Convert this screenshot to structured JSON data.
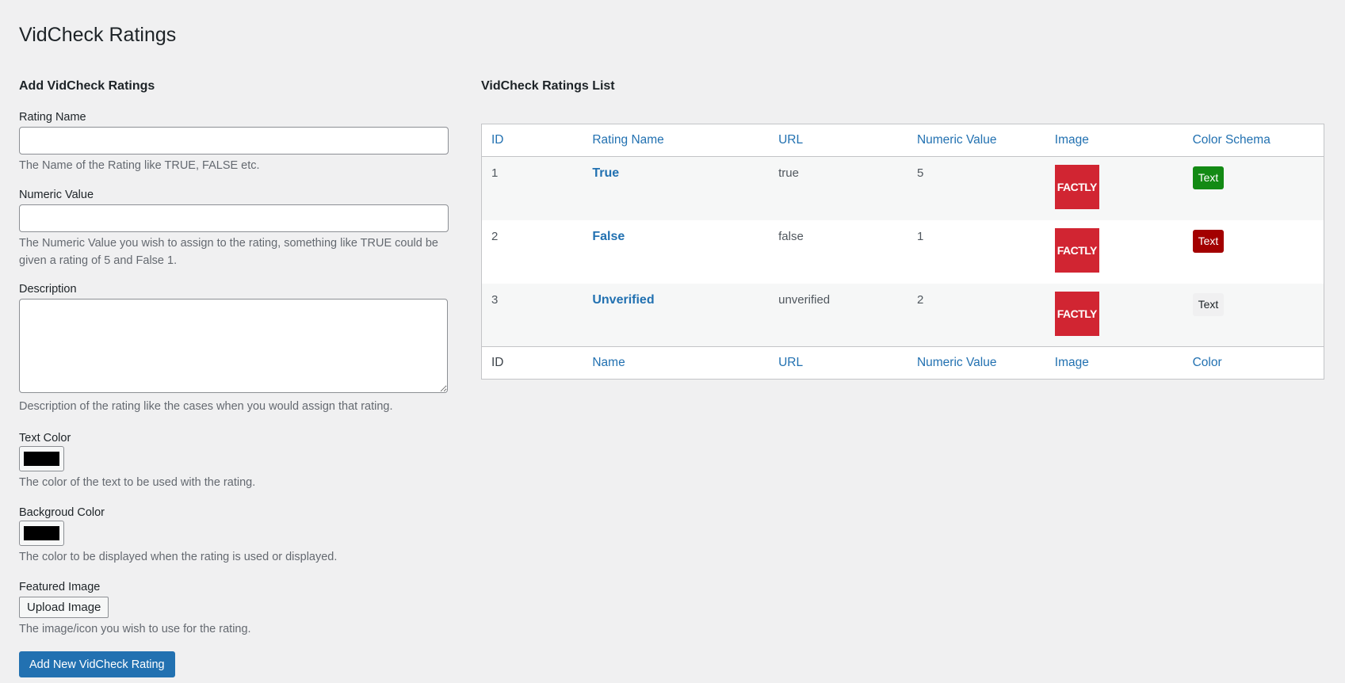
{
  "page_title": "VidCheck Ratings",
  "form": {
    "section_title": "Add VidCheck Ratings",
    "rating_name": {
      "label": "Rating Name",
      "value": "",
      "help": "The Name of the Rating like TRUE, FALSE etc."
    },
    "numeric_value": {
      "label": "Numeric Value",
      "value": "",
      "help": "The Numeric Value you wish to assign to the rating, something like TRUE could be given a rating of 5 and False 1."
    },
    "description": {
      "label": "Description",
      "value": "",
      "help": "Description of the rating like the cases when you would assign that rating."
    },
    "text_color": {
      "label": "Text Color",
      "value": "#000000",
      "help": "The color of the text to be used with the rating."
    },
    "background_color": {
      "label": "Backgroud Color",
      "value": "#000000",
      "help": "The color to be displayed when the rating is used or displayed."
    },
    "featured_image": {
      "label": "Featured Image",
      "button": "Upload Image",
      "help": "The image/icon you wish to use for the rating."
    },
    "submit_label": "Add New VidCheck Rating"
  },
  "list": {
    "section_title": "VidCheck Ratings List",
    "header": [
      "ID",
      "Rating Name",
      "URL",
      "Numeric Value",
      "Image",
      "Color Schema"
    ],
    "footer": [
      "ID",
      "Name",
      "URL",
      "Numeric Value",
      "Image",
      "Color"
    ],
    "rows": [
      {
        "id": "1",
        "name": "True",
        "url": "true",
        "numeric": "5",
        "image_text": "FACTLY",
        "badge_text": "Text",
        "badge_bg": "#138a14",
        "badge_fg": "#ffffff"
      },
      {
        "id": "2",
        "name": "False",
        "url": "false",
        "numeric": "1",
        "image_text": "FACTLY",
        "badge_text": "Text",
        "badge_bg": "#a30000",
        "badge_fg": "#ffffff"
      },
      {
        "id": "3",
        "name": "Unverified",
        "url": "unverified",
        "numeric": "2",
        "image_text": "FACTLY",
        "badge_text": "Text",
        "badge_bg": "#f0f0f1",
        "badge_fg": "#1d2327"
      }
    ]
  },
  "colors": {
    "accent": "#2271b1",
    "logo_red": "#d12532"
  }
}
